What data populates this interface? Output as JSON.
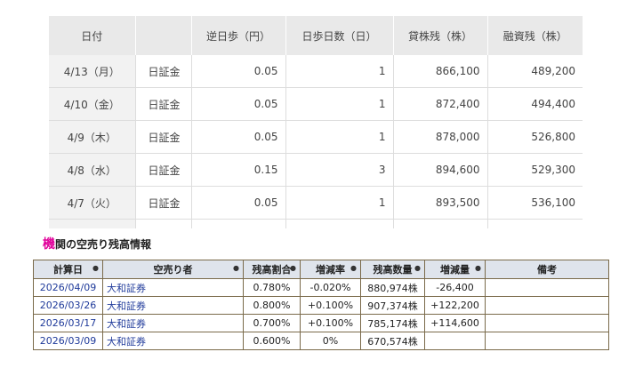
{
  "top_table": {
    "headers": [
      "日付",
      "",
      "逆日歩（円）",
      "日歩日数（日）",
      "貸株残（株）",
      "融資残（株）"
    ],
    "rows": [
      {
        "date": "4/13（月）",
        "type": "日証金",
        "gyakuhibu": "0.05",
        "days": "1",
        "kashikabu": "866,100",
        "yushi": "489,200"
      },
      {
        "date": "4/10（金）",
        "type": "日証金",
        "gyakuhibu": "0.05",
        "days": "1",
        "kashikabu": "872,400",
        "yushi": "494,400"
      },
      {
        "date": "4/9（木）",
        "type": "日証金",
        "gyakuhibu": "0.05",
        "days": "1",
        "kashikabu": "878,000",
        "yushi": "526,800"
      },
      {
        "date": "4/8（水）",
        "type": "日証金",
        "gyakuhibu": "0.15",
        "days": "3",
        "kashikabu": "894,600",
        "yushi": "529,300"
      },
      {
        "date": "4/7（火）",
        "type": "日証金",
        "gyakuhibu": "0.05",
        "days": "1",
        "kashikabu": "893,500",
        "yushi": "536,100"
      }
    ]
  },
  "section": {
    "heading_first_char": "機",
    "heading_rest": "関の空売り残高情報"
  },
  "short_table": {
    "headers": [
      "計算日",
      "空売り者",
      "残高割合",
      "増減率",
      "残高数量",
      "増減量",
      "備考"
    ],
    "sort_glyph": "●",
    "rows": [
      {
        "date": "2026/04/09",
        "firm": "大和証券",
        "ratio": "0.780%",
        "rate": "-0.020%",
        "rate_sign": "neg",
        "qty": "880,974株",
        "change": "-26,400",
        "change_sign": "neg",
        "note": ""
      },
      {
        "date": "2026/03/26",
        "firm": "大和証券",
        "ratio": "0.800%",
        "rate": "+0.100%",
        "rate_sign": "pos",
        "qty": "907,374株",
        "change": "+122,200",
        "change_sign": "pos",
        "note": ""
      },
      {
        "date": "2026/03/17",
        "firm": "大和証券",
        "ratio": "0.700%",
        "rate": "+0.100%",
        "rate_sign": "pos",
        "qty": "785,174株",
        "change": "+114,600",
        "change_sign": "pos",
        "note": ""
      },
      {
        "date": "2026/03/09",
        "firm": "大和証券",
        "ratio": "0.600%",
        "rate": "0%",
        "rate_sign": "zero",
        "qty": "670,574株",
        "change": "",
        "change_sign": "zero",
        "note": ""
      }
    ]
  },
  "colors": {
    "accent_pink": "#e0009a",
    "positive": "#e0342e",
    "negative": "#2a8bd6",
    "link_blue": "#1f3a9a",
    "header_bg": "#dfe4ec"
  }
}
